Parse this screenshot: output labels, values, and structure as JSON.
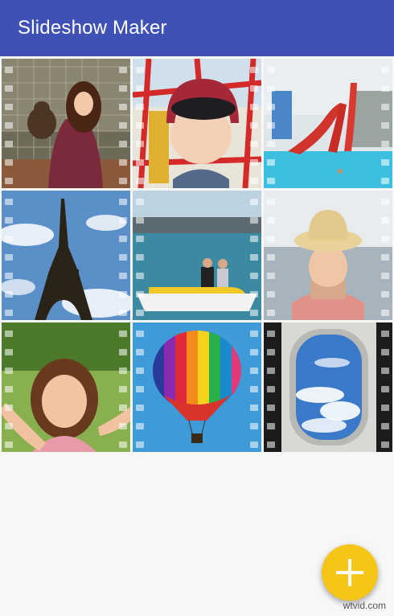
{
  "app_bar": {
    "title": "Slideshow Maker",
    "color": "#3f51b5"
  },
  "grid": {
    "tiles": [
      {
        "subject": "girl-with-bear-photo",
        "filmstrip": true
      },
      {
        "subject": "child-with-helmet-photo",
        "filmstrip": true
      },
      {
        "subject": "waterslide-pool-photo",
        "filmstrip": true
      },
      {
        "subject": "eiffel-tower-photo",
        "filmstrip": true
      },
      {
        "subject": "pedal-boat-photo",
        "filmstrip": true
      },
      {
        "subject": "girl-with-hat-photo",
        "filmstrip": true
      },
      {
        "subject": "smiling-girl-photo",
        "filmstrip": true
      },
      {
        "subject": "hot-air-balloon-photo",
        "filmstrip": true
      },
      {
        "subject": "airplane-window-photo",
        "filmstrip": true
      }
    ]
  },
  "fab": {
    "icon": "plus-icon",
    "color": "#f5c518"
  },
  "watermark": {
    "text": "wtvid.com"
  }
}
